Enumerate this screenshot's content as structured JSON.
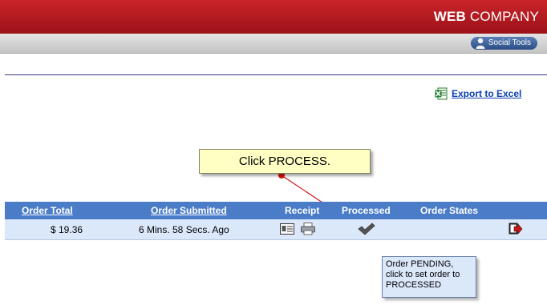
{
  "header": {
    "brand_bold": "WEB",
    "brand_rest": " COMPANY",
    "social_button": "Social Tools"
  },
  "export": {
    "label": "Export to Excel",
    "icon": "excel-icon"
  },
  "callout": {
    "text": "Click PROCESS."
  },
  "table": {
    "headers": [
      "Order Total",
      "Order Submitted",
      "Receipt",
      "Processed",
      "Order States"
    ],
    "rows": [
      {
        "order_total": "$ 19.36",
        "order_submitted": "6 Mins. 58 Secs. Ago"
      }
    ]
  },
  "tooltip": {
    "text": "Order PENDING, click to set order to PROCESSED"
  },
  "colors": {
    "header_red": "#b01a20",
    "table_header_blue": "#4a7cc8",
    "row_blue": "#dbe8fa",
    "callout_yellow": "#ffffc4",
    "arrow_red": "#e01010"
  }
}
